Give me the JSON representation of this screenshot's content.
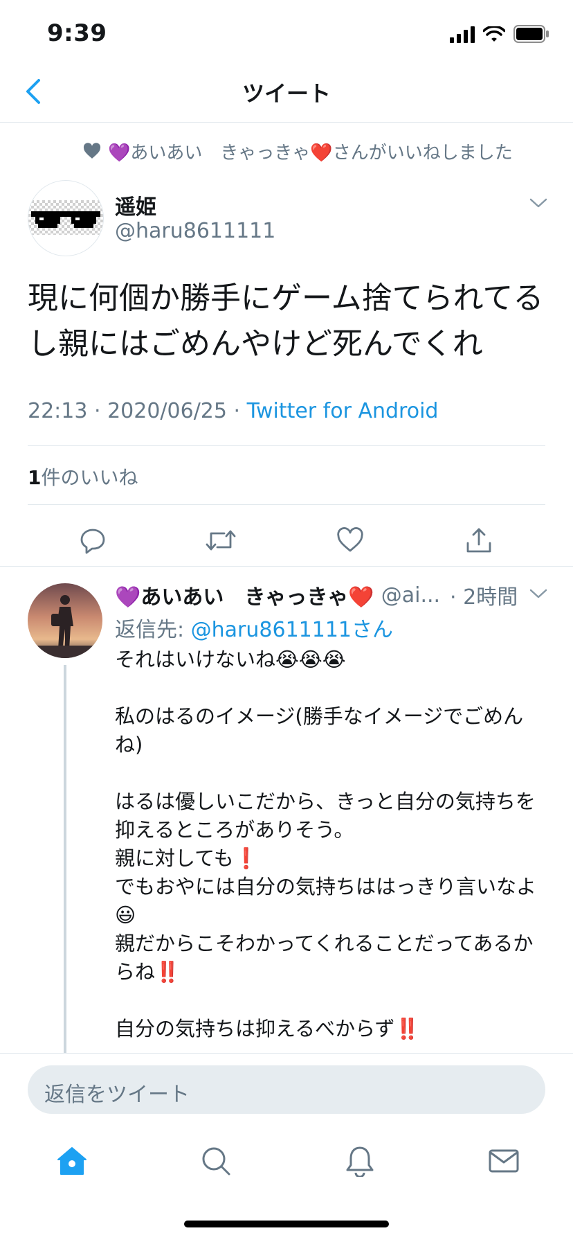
{
  "status_bar": {
    "time": "9:39"
  },
  "header": {
    "title": "ツイート"
  },
  "liked_by": {
    "text": "💜あいあい　きゃっきゃ❤️さんがいいねしました"
  },
  "tweet": {
    "author_name": "遥姫",
    "author_handle": "@haru8611111",
    "text": "現に何個か勝手にゲーム捨てられてるし親にはごめんやけど死んでくれ",
    "time_date": "22:13 · 2020/06/25 · ",
    "client": "Twitter for Android",
    "likes_count": "1",
    "likes_label": "件のいいね"
  },
  "reply": {
    "name": "💜あいあい　きゃっきゃ❤️",
    "handle": "@ai...",
    "time": "· 2時間",
    "reply_to_label": "返信先: ",
    "reply_to_handle": "@haru8611111さん",
    "lines": [
      "それはいけないね😭😭😭",
      "",
      "私のはるのイメージ(勝手なイメージでごめんね)",
      "",
      "はるは優しいこだから、きっと自分の気持ちを抑えるところがありそう。",
      "親に対しても❗️",
      "でもおやには自分の気持ちははっきり言いなよ😃",
      "親だからこそわかってくれることだってあるからね‼️",
      "",
      "自分の気持ちは抑えるべからず‼️"
    ]
  },
  "compose": {
    "placeholder": "返信をツイート"
  },
  "icons": {
    "back": "chevron-left-icon",
    "reply": "comment-icon",
    "retweet": "retweet-icon",
    "like": "heart-icon",
    "share": "share-icon",
    "home": "home-icon",
    "search": "search-icon",
    "notifications": "bell-icon",
    "messages": "mail-icon"
  },
  "colors": {
    "accent": "#1da1f2",
    "link": "#1b95e0",
    "secondary_text": "#657786"
  }
}
